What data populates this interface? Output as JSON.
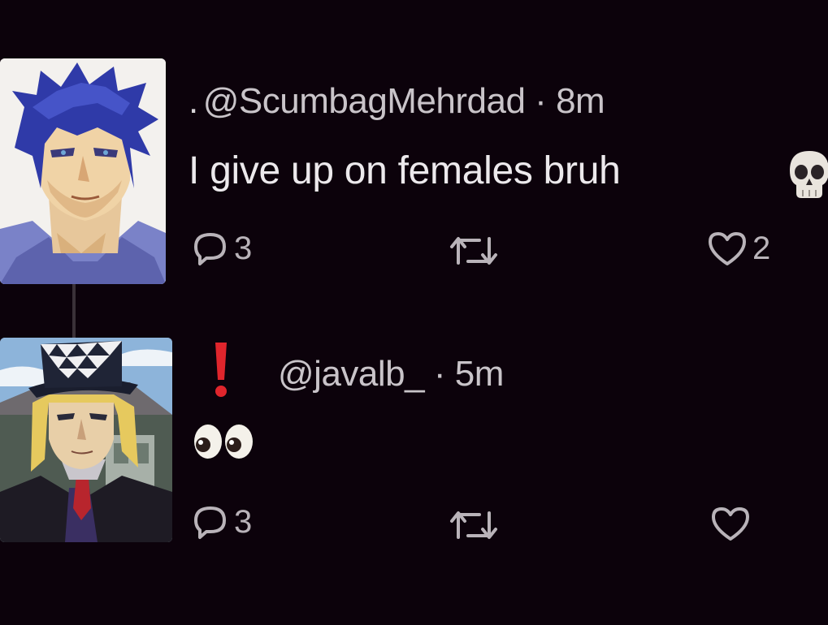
{
  "tweets": [
    {
      "prefix": ".",
      "handle": "@ScumbagMehrdad",
      "time": "8m",
      "text": "I give up on females bruh",
      "emoji": "skull",
      "reply_count": "3",
      "like_count": "2"
    },
    {
      "prefix": "❗",
      "handle": "@javalb_",
      "time": "5m",
      "text": "👀",
      "reply_count": "3",
      "like_count": ""
    }
  ],
  "colors": {
    "background": "#0c020b",
    "text": "#ece9ec",
    "muted": "#b9b3b9"
  },
  "icons": [
    "reply-icon",
    "retweet-icon",
    "heart-icon",
    "skull-emoji",
    "eyes-emoji",
    "exclamation-emoji"
  ]
}
